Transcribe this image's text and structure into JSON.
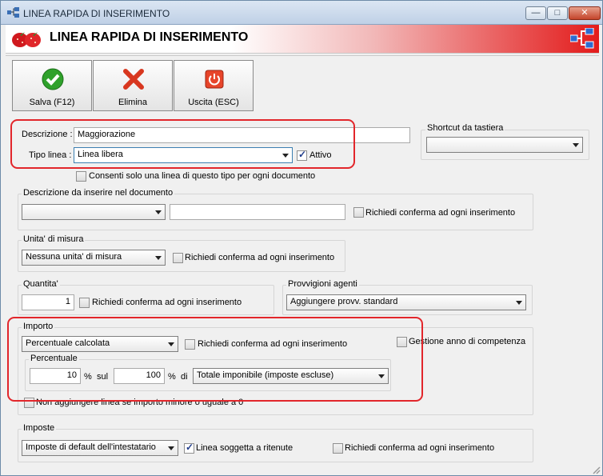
{
  "window": {
    "title": "LINEA RAPIDA DI INSERIMENTO",
    "header_title": "LINEA RAPIDA DI INSERIMENTO"
  },
  "toolbar": {
    "save": "Salva (F12)",
    "delete": "Elimina",
    "exit": "Uscita (ESC)"
  },
  "form": {
    "descrizione_label": "Descrizione :",
    "descrizione_value": "Maggiorazione",
    "tipo_linea_label": "Tipo linea :",
    "tipo_linea_value": "Linea libera",
    "attivo_label": "Attivo",
    "consenti_label": "Consenti solo una linea di questo tipo per ogni documento"
  },
  "shortcut": {
    "label": "Shortcut da tastiera",
    "value": ""
  },
  "descrizione_doc": {
    "label": "Descrizione da inserire nel documento",
    "combo_value": "",
    "text_value": "",
    "confirm_label": "Richiedi conferma ad ogni inserimento"
  },
  "unita": {
    "label": "Unita' di misura",
    "value": "Nessuna unita' di misura",
    "confirm_label": "Richiedi conferma ad ogni inserimento"
  },
  "quantita": {
    "label": "Quantita'",
    "value": "1",
    "confirm_label": "Richiedi conferma ad ogni inserimento"
  },
  "provvigioni": {
    "label": "Provvigioni agenti",
    "value": "Aggiungere provv. standard"
  },
  "importo": {
    "label": "Importo",
    "type_value": "Percentuale calcolata",
    "confirm_label": "Richiedi conferma ad ogni inserimento",
    "gestione_label": "Gestione anno di competenza",
    "percentuale_label": "Percentuale",
    "pct_value": "10",
    "pct_sign": "%",
    "sul_label": "sul",
    "base_value": "100",
    "pct_sign2": "%",
    "di_label": "di",
    "base_type": "Totale imponibile (imposte escluse)",
    "non_aggiungere_label": "Non aggiungere linea se importo minore o uguale a 0"
  },
  "imposte": {
    "label": "Imposte",
    "value": "Imposte di default dell'intestatario",
    "ritenute_label": "Linea soggetta a ritenute",
    "confirm_label": "Richiedi conferma ad ogni inserimento"
  },
  "colors": {
    "accent_red": "#e31b1b",
    "highlight_red": "#e2262b"
  }
}
